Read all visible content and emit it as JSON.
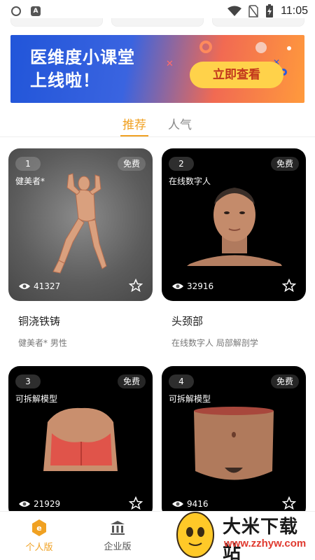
{
  "status_bar": {
    "time": "11:05"
  },
  "banner": {
    "title_line1": "医维度小课堂",
    "title_line2": "上线啦！",
    "button_label": "立即查看",
    "colors": {
      "left": "#2155d9",
      "right": "#ff9a3c",
      "button": "#ffd24a"
    }
  },
  "tabs": [
    {
      "label": "推荐",
      "active": true
    },
    {
      "label": "人气",
      "active": false
    }
  ],
  "cards": [
    {
      "number": "1",
      "badge": "免费",
      "subtitle": "健美者*",
      "views": "41327",
      "title": "铜浇铁铸",
      "tags": "健美者* 男性"
    },
    {
      "number": "2",
      "badge": "免费",
      "subtitle": "在线数字人",
      "views": "32916",
      "title": "头颈部",
      "tags": "在线数字人 局部解剖学"
    },
    {
      "number": "3",
      "badge": "免费",
      "subtitle": "可拆解模型",
      "views": "21929"
    },
    {
      "number": "4",
      "badge": "免费",
      "subtitle": "可拆解模型",
      "views": "9416"
    }
  ],
  "bottom_nav": [
    {
      "label": "个人版",
      "icon": "personal-e-icon",
      "active": true
    },
    {
      "label": "企业版",
      "icon": "building-icon",
      "active": false
    }
  ],
  "watermark": {
    "text": "大米下载站",
    "url": "www.zzhyw.com"
  },
  "accent_color": "#f0a122"
}
